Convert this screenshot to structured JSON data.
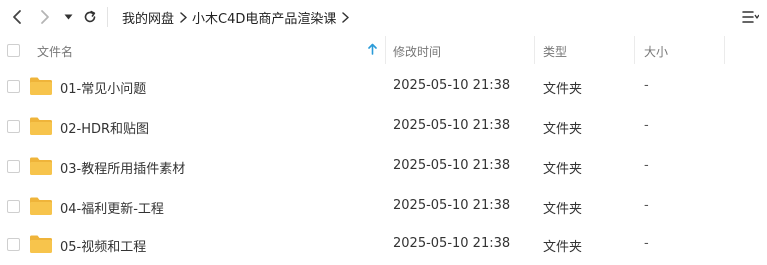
{
  "nav": {
    "breadcrumbs": [
      "我的网盘",
      "小木C4D电商产品渲染课"
    ]
  },
  "columns": {
    "name": "文件名",
    "modified": "修改时间",
    "type": "类型",
    "size": "大小"
  },
  "files": [
    {
      "name": "01-常见小问题",
      "modified": "2025-05-10 21:38",
      "type": "文件夹",
      "size": "-"
    },
    {
      "name": "02-HDR和贴图",
      "modified": "2025-05-10 21:38",
      "type": "文件夹",
      "size": "-"
    },
    {
      "name": "03-教程所用插件素材",
      "modified": "2025-05-10 21:38",
      "type": "文件夹",
      "size": "-"
    },
    {
      "name": "04-福利更新-工程",
      "modified": "2025-05-10 21:38",
      "type": "文件夹",
      "size": "-"
    },
    {
      "name": "05-视频和工程",
      "modified": "2025-05-10 21:38",
      "type": "文件夹",
      "size": "-"
    }
  ],
  "colors": {
    "folder": "#f7c44c",
    "folder_tab": "#efb43a",
    "sort_arrow": "#2a9bd8"
  },
  "icons": [
    "back-arrow-icon",
    "forward-arrow-icon",
    "history-dropdown-icon",
    "refresh-icon",
    "breadcrumb-chevron-icon",
    "list-menu-icon",
    "sort-ascending-icon",
    "folder-icon"
  ]
}
